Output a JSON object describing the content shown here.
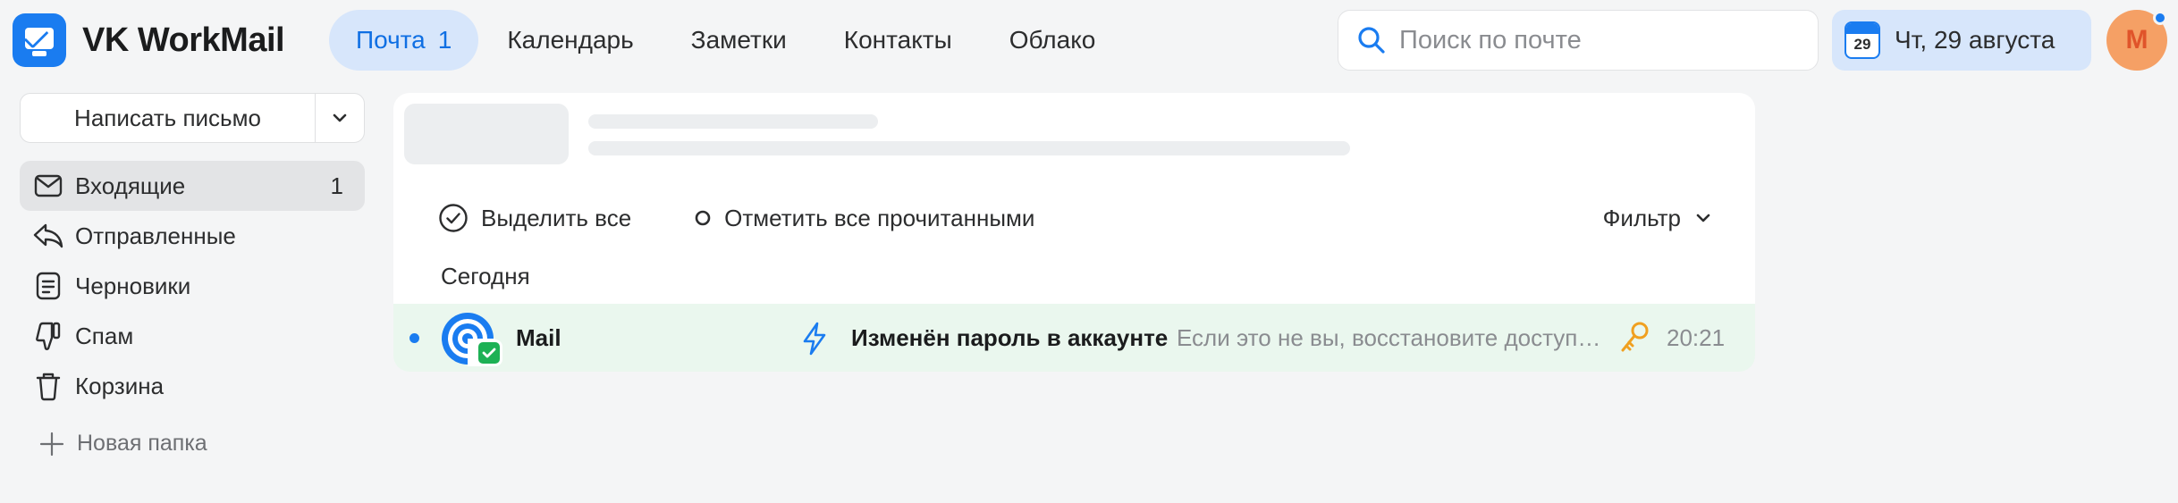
{
  "app": {
    "name": "VK WorkMail"
  },
  "nav": {
    "items": [
      {
        "label": "Почта",
        "count": "1",
        "active": true
      },
      {
        "label": "Календарь"
      },
      {
        "label": "Заметки"
      },
      {
        "label": "Контакты"
      },
      {
        "label": "Облако"
      }
    ]
  },
  "search": {
    "placeholder": "Поиск по почте"
  },
  "date": {
    "day": "29",
    "text": "Чт, 29 августа"
  },
  "user": {
    "avatar_letter": "M"
  },
  "sidebar": {
    "compose_label": "Написать письмо",
    "folders": [
      {
        "label": "Входящие",
        "count": "1",
        "icon": "inbox-icon",
        "active": true
      },
      {
        "label": "Отправленные",
        "icon": "sent-icon"
      },
      {
        "label": "Черновики",
        "icon": "drafts-icon"
      },
      {
        "label": "Спам",
        "icon": "spam-icon"
      },
      {
        "label": "Корзина",
        "icon": "trash-icon"
      }
    ],
    "new_folder_label": "Новая папка"
  },
  "toolbar": {
    "select_all": "Выделить все",
    "mark_all_read": "Отметить все прочитанными",
    "filter": "Фильтр"
  },
  "messages": {
    "section": "Сегодня",
    "items": [
      {
        "sender": "Mail",
        "subject": "Изменён пароль в аккаунте",
        "snippet": "Если это не вы, восстановите доступ к аккаунту",
        "time": "20:21",
        "unread": true
      }
    ]
  },
  "colors": {
    "accent": "#1a7cf0",
    "active_nav_bg": "#d7e6fb",
    "row_highlight": "#eaf7ee",
    "verified": "#1db155",
    "key": "#f0a020"
  }
}
